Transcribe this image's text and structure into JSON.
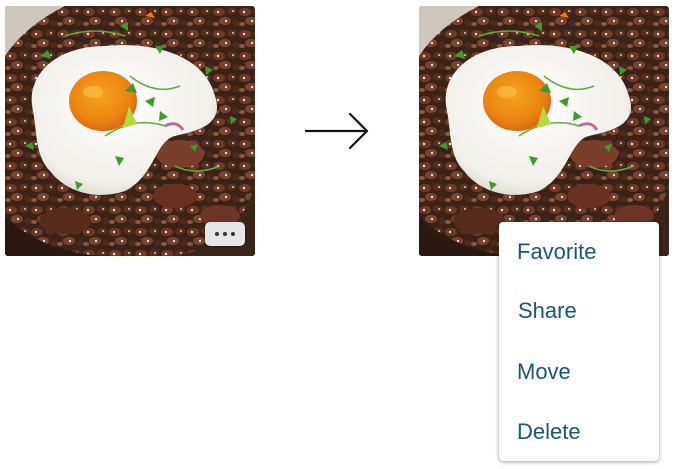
{
  "left_photo": {
    "description_icon": "food-photo-icon",
    "more_button_icon": "ellipsis-icon"
  },
  "transition_icon": "arrow-right-icon",
  "right_photo": {
    "description_icon": "food-photo-icon"
  },
  "context_menu": {
    "items": [
      {
        "label": "Favorite"
      },
      {
        "label": "Share"
      },
      {
        "label": "Move"
      },
      {
        "label": "Delete"
      }
    ]
  },
  "colors": {
    "menu_text": "#1a5679",
    "more_button_bg": "#e6e6e6"
  }
}
